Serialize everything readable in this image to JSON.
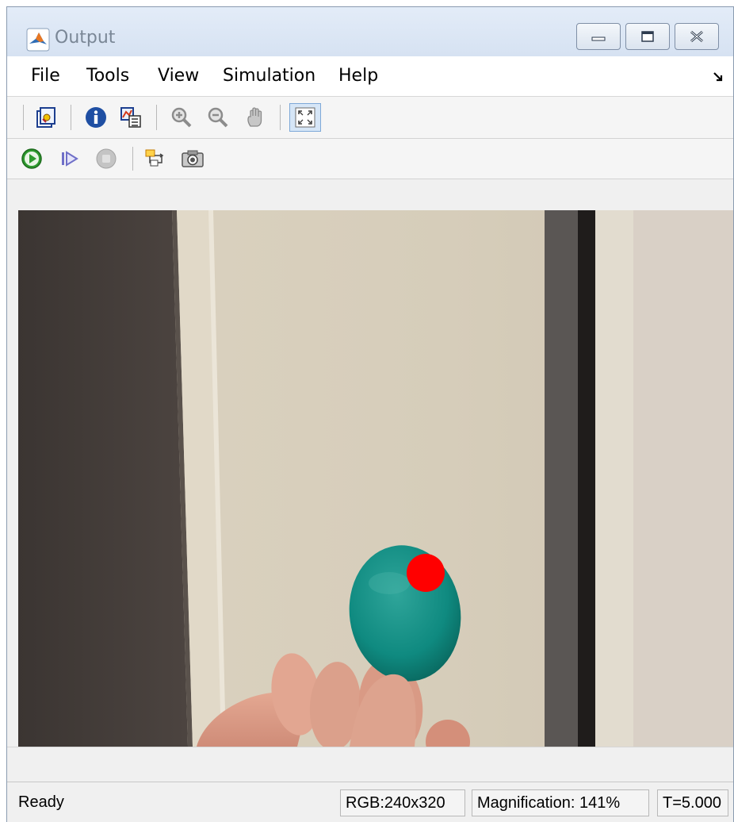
{
  "window": {
    "title": "Output"
  },
  "menubar": {
    "items": [
      "File",
      "Tools",
      "View",
      "Simulation",
      "Help"
    ]
  },
  "toolbar1": {
    "icons": [
      "parameters-icon",
      "info-icon",
      "copy-to-scope-icon",
      "zoom-in-icon",
      "zoom-out-icon",
      "pan-icon",
      "fit-to-view-icon"
    ]
  },
  "toolbar2": {
    "icons": [
      "run-icon",
      "step-forward-icon",
      "stop-icon",
      "highlight-model-icon",
      "snapshot-icon"
    ]
  },
  "colors": {
    "run_green": "#2e9a2e",
    "marker_red": "#ff0000",
    "ball_teal": "#0f8a80"
  },
  "status": {
    "text": "Ready",
    "format": "RGB:240x320",
    "magnification": "Magnification: 141%",
    "time": "T=5.000"
  }
}
